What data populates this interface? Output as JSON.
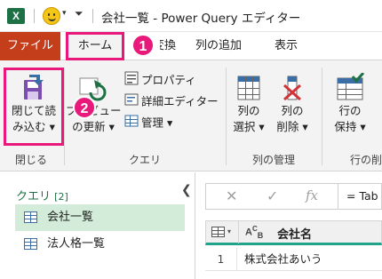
{
  "titlebar": {
    "app_icon": "X",
    "qa_icon": "↩",
    "title": "会社一覧 - Power Query エディター"
  },
  "tabs": {
    "file": "ファイル",
    "home": "ホーム",
    "transform": "変換",
    "add_column": "列の追加",
    "view": "表示"
  },
  "badges": {
    "one": "1",
    "two": "2"
  },
  "ribbon": {
    "close": {
      "close_load_line1": "閉じて読",
      "close_load_line2": "み込む",
      "group_label": "閉じる"
    },
    "query": {
      "refresh_line1": "プレビュー",
      "refresh_line2": "の更新",
      "properties": "プロパティ",
      "advanced_editor": "詳細エディター",
      "manage": "管理",
      "group_label": "クエリ"
    },
    "manage_columns": {
      "choose_line1": "列の",
      "choose_line2": "選択",
      "remove_line1": "列の",
      "remove_line2": "削除",
      "group_label": "列の管理"
    },
    "reduce_rows": {
      "keep_line1": "行の",
      "keep_line2": "保持",
      "group_label": "行の削"
    }
  },
  "queries_pane": {
    "title": "クエリ",
    "count": "[2]",
    "items": [
      {
        "label": "会社一覧"
      },
      {
        "label": "法人格一覧"
      }
    ]
  },
  "formula_bar": {
    "cancel": "✕",
    "confirm": "✓",
    "fx": "fx",
    "text": "= Tab"
  },
  "grid": {
    "type_label": "A",
    "type_sub": "B",
    "type_sub2": "C",
    "column_name": "会社名",
    "rows": [
      {
        "num": "1",
        "value": "株式会社あいう"
      }
    ]
  },
  "colors": {
    "accent_pink": "#e8197a",
    "file_tab": "#c43e1c",
    "excel_green": "#1e7145",
    "selected_bg": "#d2ecd9",
    "header_underline": "#1fa38a"
  }
}
